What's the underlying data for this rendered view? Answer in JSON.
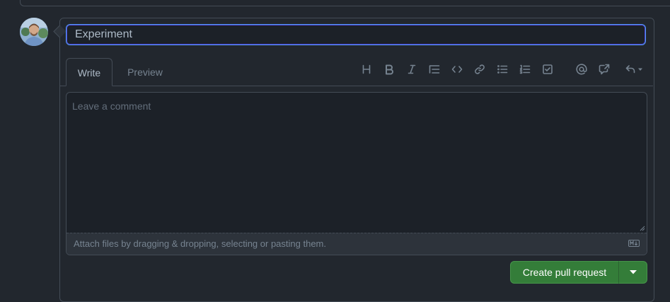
{
  "title_input": {
    "value": "Experiment"
  },
  "tabs": [
    {
      "label": "Write",
      "active": true
    },
    {
      "label": "Preview",
      "active": false
    }
  ],
  "toolbar": [
    "heading-icon",
    "bold-icon",
    "italic-icon",
    "quote-icon",
    "code-icon",
    "link-icon",
    "bulleted-list-icon",
    "numbered-list-icon",
    "task-list-icon",
    "mention-icon",
    "cross-reference-icon",
    "saved-reply-icon"
  ],
  "comment": {
    "placeholder": "Leave a comment",
    "value": ""
  },
  "attach": {
    "text": "Attach files by dragging & dropping, selecting or pasting them."
  },
  "actions": {
    "primary_label": "Create pull request"
  },
  "colors": {
    "accent": "#539bf5",
    "button": "#347d39",
    "background": "#22272e"
  }
}
